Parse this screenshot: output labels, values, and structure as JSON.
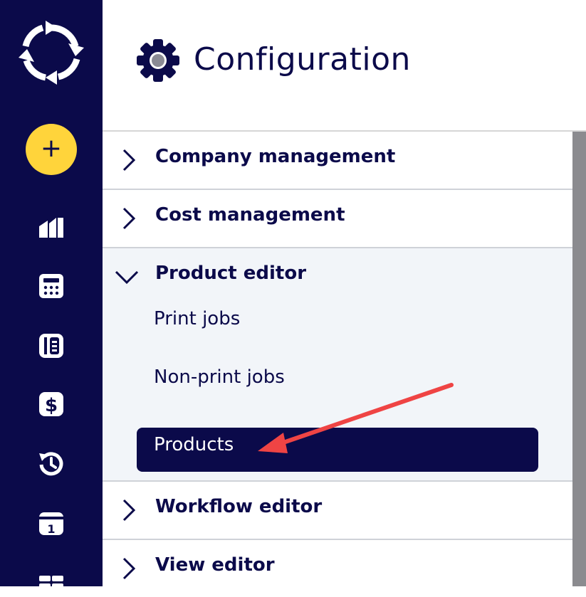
{
  "header": {
    "title": "Configuration",
    "icon": "gear-icon"
  },
  "sidebar": {
    "logo": "cycle-arrows-logo",
    "add_label": "+",
    "items": [
      {
        "icon": "factory-icon"
      },
      {
        "icon": "calculator-icon"
      },
      {
        "icon": "ledger-icon"
      },
      {
        "icon": "dollar-icon"
      },
      {
        "icon": "history-clock-icon"
      },
      {
        "icon": "calendar-icon",
        "text": "1"
      },
      {
        "icon": "grid-icon"
      }
    ]
  },
  "sections": [
    {
      "label": "Company management",
      "expanded": false
    },
    {
      "label": "Cost management",
      "expanded": false
    },
    {
      "label": "Product editor",
      "expanded": true,
      "items": [
        "Print jobs",
        "Non-print jobs",
        "Products"
      ],
      "active": "Products"
    },
    {
      "label": "Workflow editor",
      "expanded": false
    },
    {
      "label": "View editor",
      "expanded": false
    }
  ],
  "colors": {
    "navy": "#0b0a4a",
    "accent": "#ffd43b",
    "annotation_arrow": "#ef4444"
  }
}
